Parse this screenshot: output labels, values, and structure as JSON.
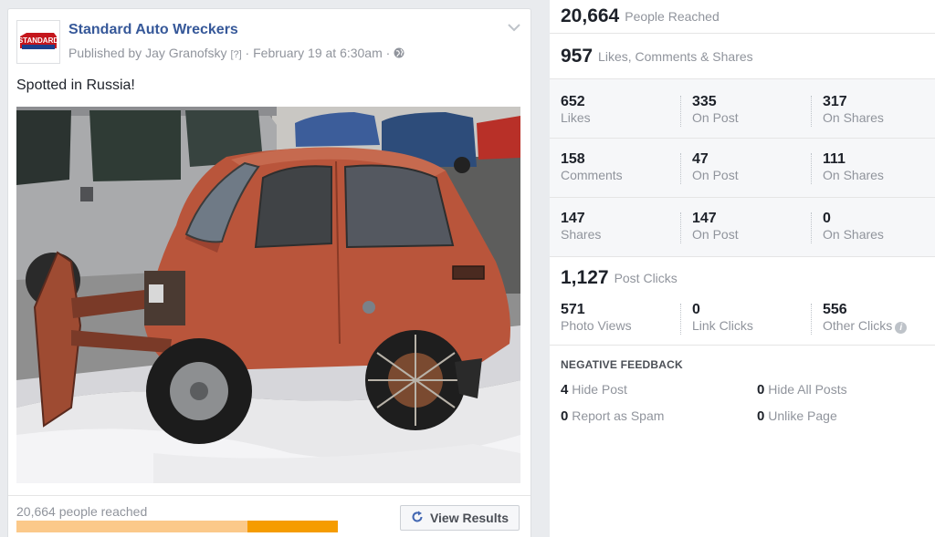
{
  "post": {
    "page_name": "Standard Auto Wreckers",
    "logo_text": "STANDARD",
    "published_prefix": "Published by ",
    "author": "Jay Granofsky",
    "help_mark": "[?]",
    "separator": " · ",
    "date": "February 19 at 6:30am",
    "separator2": " · ",
    "text": "Spotted in Russia!",
    "photo_icon": "photo-of-red-car",
    "globe_icon": "globe-icon",
    "chevron_icon": "chevron-down-icon"
  },
  "footer": {
    "reach_text": "20,664 people reached",
    "reach_bar_organic_fraction": 0.72,
    "view_results_label": "View Results",
    "refresh_icon": "refresh-icon",
    "colors": {
      "organic": "#fbc98a",
      "paid": "#f59c00"
    }
  },
  "insights": {
    "people_reached": {
      "value": "20,664",
      "label": "People Reached"
    },
    "engagement": {
      "value": "957",
      "label": "Likes, Comments & Shares"
    },
    "likes": [
      {
        "value": "652",
        "label": "Likes"
      },
      {
        "value": "335",
        "label": "On Post"
      },
      {
        "value": "317",
        "label": "On Shares"
      }
    ],
    "comments": [
      {
        "value": "158",
        "label": "Comments"
      },
      {
        "value": "47",
        "label": "On Post"
      },
      {
        "value": "111",
        "label": "On Shares"
      }
    ],
    "shares": [
      {
        "value": "147",
        "label": "Shares"
      },
      {
        "value": "147",
        "label": "On Post"
      },
      {
        "value": "0",
        "label": "On Shares"
      }
    ],
    "post_clicks": {
      "value": "1,127",
      "label": "Post Clicks"
    },
    "clicks": [
      {
        "value": "571",
        "label": "Photo Views"
      },
      {
        "value": "0",
        "label": "Link Clicks"
      },
      {
        "value": "556",
        "label": "Other Clicks"
      }
    ],
    "negative_feedback": {
      "title": "NEGATIVE FEEDBACK",
      "items": [
        {
          "value": "4",
          "label": "Hide Post"
        },
        {
          "value": "0",
          "label": "Hide All Posts"
        },
        {
          "value": "0",
          "label": "Report as Spam"
        },
        {
          "value": "0",
          "label": "Unlike Page"
        }
      ]
    }
  }
}
